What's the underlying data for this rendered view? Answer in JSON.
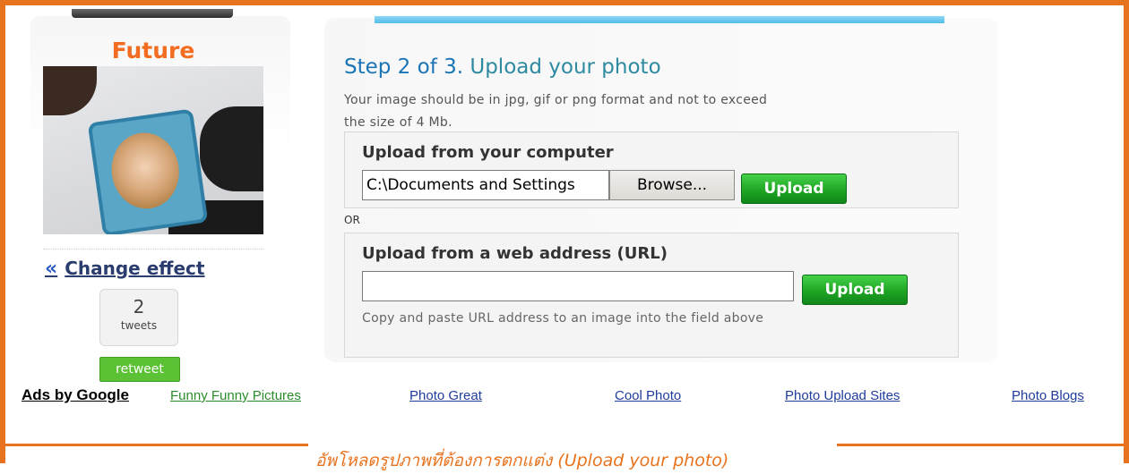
{
  "effect": {
    "title": "Future",
    "change_effect_chevron": "«",
    "change_effect_label": "Change effect",
    "tweets_count": "2",
    "tweets_label": "tweets",
    "retweet_label": "retweet"
  },
  "step": {
    "title_prefix": "Step 2 of 3.",
    "title_rest": "Upload your photo",
    "description_line1": "Your image should be in jpg, gif or png format and not to exceed",
    "description_line2": "the size of 4 Mb."
  },
  "upload_computer": {
    "heading": "Upload from your computer",
    "file_value": "C:\\Documents and Settings",
    "browse_label": "Browse...",
    "upload_label": "Upload"
  },
  "or_label": "OR",
  "upload_url": {
    "heading": "Upload from a web address (URL)",
    "url_value": "",
    "upload_label": "Upload",
    "hint": "Copy and paste URL address to an image into the field above"
  },
  "ads": {
    "label": "Ads by Google",
    "links": [
      "Funny Funny Pictures",
      "Photo Great",
      "Cool Photo",
      "Photo Upload Sites",
      "Photo Blogs"
    ]
  },
  "caption": "อัพโหลดรูปภาพที่ต้องการตกแต่ง (Upload your photo)",
  "colors": {
    "frame": "#e8731e",
    "effect_title": "#f26d21",
    "step_title": "#1a74b5",
    "upload_button": "#1fa524",
    "retweet": "#5bc236"
  }
}
